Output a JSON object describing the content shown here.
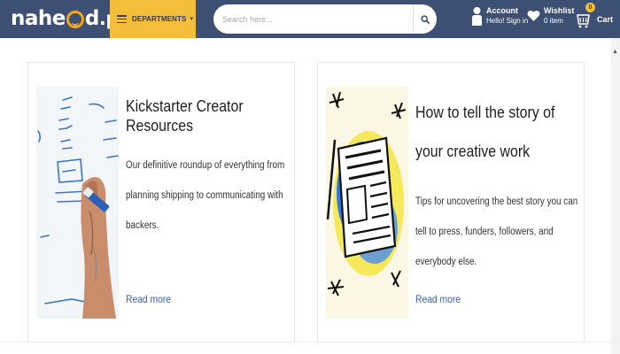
{
  "header": {
    "logo": {
      "part1": "nahe",
      "part2": "d",
      "tld": ".pk"
    },
    "departments_label": "DEPARTMENTS",
    "search": {
      "placeholder": "Search here..."
    },
    "account": {
      "title": "Account",
      "subtitle": "Hello! Sign in"
    },
    "wishlist": {
      "title": "Wishlist",
      "subtitle": "0 item"
    },
    "cart": {
      "label": "Cart",
      "count": "0"
    }
  },
  "cards": [
    {
      "title": "Kickstarter Creator Resources",
      "description": "Our definitive roundup of everything from planning shipping to communicating with backers.",
      "link": "Read more",
      "image_icon": "whiteboard-hand-marker-icon"
    },
    {
      "title": "How to tell the story of your creative work",
      "description": "Tips for uncovering the best story you can tell to press, funders, followers, and everybody else.",
      "link": "Read more",
      "image_icon": "newspaper-illustration-icon"
    }
  ],
  "colors": {
    "header_bg": "#3d4f73",
    "accent": "#f4bd3a",
    "link": "#3a5ea8"
  }
}
